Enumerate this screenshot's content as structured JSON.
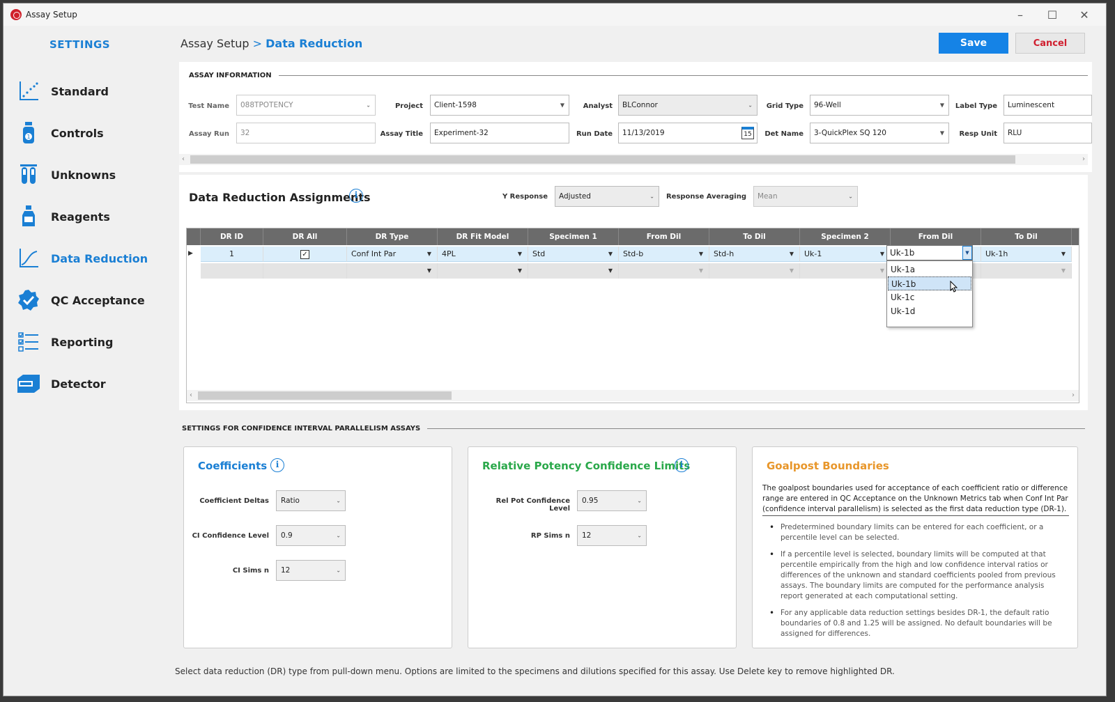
{
  "window": {
    "title": "Assay Setup",
    "controls": [
      "–",
      "☐",
      "✕"
    ]
  },
  "sidebar": {
    "title": "SETTINGS",
    "items": [
      {
        "label": "Standard",
        "icon": "line-chart-icon"
      },
      {
        "label": "Controls",
        "icon": "vial-icon"
      },
      {
        "label": "Unknowns",
        "icon": "test-tubes-icon"
      },
      {
        "label": "Reagents",
        "icon": "bottle-icon"
      },
      {
        "label": "Data Reduction",
        "icon": "curve-icon",
        "active": true
      },
      {
        "label": "QC Acceptance",
        "icon": "check-badge-icon"
      },
      {
        "label": "Reporting",
        "icon": "checklist-icon"
      },
      {
        "label": "Detector",
        "icon": "detector-icon"
      }
    ]
  },
  "header": {
    "crumb_root": "Assay Setup",
    "crumb_sep": ">",
    "crumb_current": "Data Reduction",
    "save_label": "Save",
    "cancel_label": "Cancel"
  },
  "assay_info": {
    "heading": "ASSAY INFORMATION",
    "test_name_label": "Test Name",
    "test_name": "088TPOTENCY",
    "assay_run_label": "Assay Run",
    "assay_run": "32",
    "project_label": "Project",
    "project": "Client-1598",
    "assay_title_label": "Assay Title",
    "assay_title": "Experiment-32",
    "analyst_label": "Analyst",
    "analyst": "BLConnor",
    "run_date_label": "Run Date",
    "run_date": "11/13/2019",
    "calendar_day": "15",
    "grid_type_label": "Grid Type",
    "grid_type": "96-Well",
    "det_name_label": "Det Name",
    "det_name": "3-QuickPlex SQ 120",
    "label_type_label": "Label Type",
    "label_type": "Luminescent",
    "resp_unit_label": "Resp Unit",
    "resp_unit": "RLU"
  },
  "dra": {
    "title": "Data Reduction Assignments",
    "y_response_label": "Y Response",
    "y_response": "Adjusted",
    "response_avg_label": "Response Averaging",
    "response_avg": "Mean",
    "columns": [
      "DR ID",
      "DR All",
      "DR Type",
      "DR Fit Model",
      "Specimen 1",
      "From Dil",
      "To Dil",
      "Specimen 2",
      "From Dil",
      "To Dil"
    ],
    "row1": {
      "id": "1",
      "all_checked": "✓",
      "type": "Conf Int Par",
      "fit": "4PL",
      "spec1": "Std",
      "from1": "Std-b",
      "to1": "Std-h",
      "spec2": "Uk-1",
      "from2": "Uk-1b",
      "to2": "Uk-1h"
    },
    "dropdown_options": [
      "Uk-1a",
      "Uk-1b",
      "Uk-1c",
      "Uk-1d"
    ]
  },
  "ci_section": {
    "heading": "SETTINGS FOR CONFIDENCE INTERVAL PARALLELISM ASSAYS",
    "coefficients": {
      "title": "Coefficients",
      "deltas_label": "Coefficient Deltas",
      "deltas": "Ratio",
      "ci_level_label": "CI Confidence Level",
      "ci_level": "0.9",
      "ci_sims_label": "CI Sims n",
      "ci_sims": "12"
    },
    "rp_limits": {
      "title": "Relative Potency Confidence Limits",
      "level_label": "Rel Pot Confidence Level",
      "level": "0.95",
      "sims_label": "RP Sims n",
      "sims": "12"
    },
    "goalpost": {
      "title": "Goalpost Boundaries",
      "intro": "The goalpost boundaries used for acceptance of each coefficient ratio or difference range are entered in QC Acceptance on the Unknown Metrics tab when Conf Int Par (confidence interval parallelism) is selected as the first data reduction type (DR-1).",
      "bullets": [
        "Predetermined boundary limits can be entered for each coefficient, or a percentile level can be selected.",
        "If a percentile level is selected, boundary limits will be computed at that percentile empirically from the high and low confidence interval ratios or differences of the unknown and standard coefficients pooled from previous assays.  The boundary limits are computed for the performance analysis report generated at each computational setting.",
        "For any applicable data reduction settings besides DR-1, the default ratio boundaries of 0.8 and 1.25 will be assigned.  No default boundaries will be assigned for differences."
      ]
    }
  },
  "footer": "Select data reduction (DR) type from pull-down menu.  Options are limited to the specimens and dilutions specified for this assay. Use Delete key to remove highlighted DR.",
  "colors": {
    "accent": "#1a7fd4",
    "save": "#1583e6",
    "cancel": "#d01f2f",
    "rp_title": "#2aa84a",
    "goal_title": "#e8962a"
  }
}
